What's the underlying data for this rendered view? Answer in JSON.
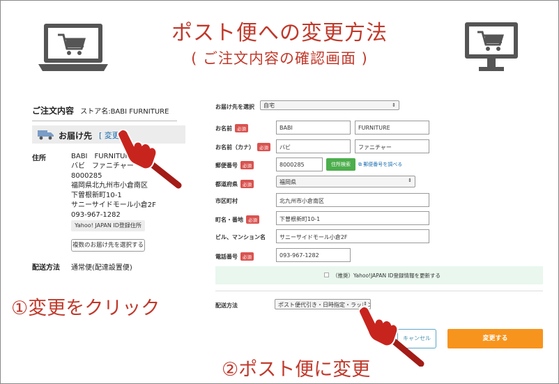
{
  "header": {
    "title": "ポスト便への変更方法",
    "subtitle": "( ご注文内容の確認画面 )"
  },
  "icons": {
    "laptop": "laptop-cart-icon",
    "monitor": "monitor-cart-icon"
  },
  "colors": {
    "accent": "#c0392b",
    "submit": "#f7941d",
    "zip_search": "#4cae4c",
    "required": "#d9534f",
    "band": "#e9f7ee",
    "link": "#1a6fb0"
  },
  "left": {
    "order_title": "ご注文内容",
    "store_label": "ストア名:BABI FURNITURE",
    "delivery_label": "お届け先",
    "change_link": "[ 変更",
    "address_label": "住所",
    "address_lines": [
      "BABI　FURNITURE",
      "バビ　ファニチャー",
      "8000285",
      "福岡県北九州市小倉南区",
      "下曽根新町10-1",
      "サニーサイドモール小倉2F",
      "093-967-1282"
    ],
    "yahoo_button": "Yahoo! JAPAN ID登録住所",
    "multi_button": "複数のお届け先を選択する",
    "shipping_label": "配送方法",
    "shipping_value": "通常便(配達設置便)"
  },
  "annotations": {
    "step1": "①変更をクリック",
    "step2": "②ポスト便に変更"
  },
  "form": {
    "select_dest_label": "お届け先を選択",
    "select_dest_value": "自宅",
    "required_badge": "必須",
    "name_label": "お名前",
    "name_first": "BABI",
    "name_last": "FURNITURE",
    "kana_label": "お名前（カナ）",
    "kana_first": "バビ",
    "kana_last": "ファニチャー",
    "zip_label": "郵便番号",
    "zip_value": "8000285",
    "zip_button": "住所検索",
    "zip_link": "郵便番号を調べる",
    "pref_label": "都道府県",
    "pref_value": "福岡県",
    "city_label": "市区町村",
    "city_value": "北九州市小倉南区",
    "street_label": "町名・番地",
    "street_value": "下曽根新町10-1",
    "building_label": "ビル、マンション名",
    "building_value": "サニーサイドモール小倉2F",
    "phone_label": "電話番号",
    "phone_value": "093-967-1282",
    "yahoo_update": "（推奨）Yahoo!JAPAN ID登録情報を更新する",
    "shipping_label": "配送方法",
    "shipping_value": "ポスト便代引き・日時指定・ラッピン",
    "cancel": "キャンセル",
    "submit": "変更する"
  }
}
